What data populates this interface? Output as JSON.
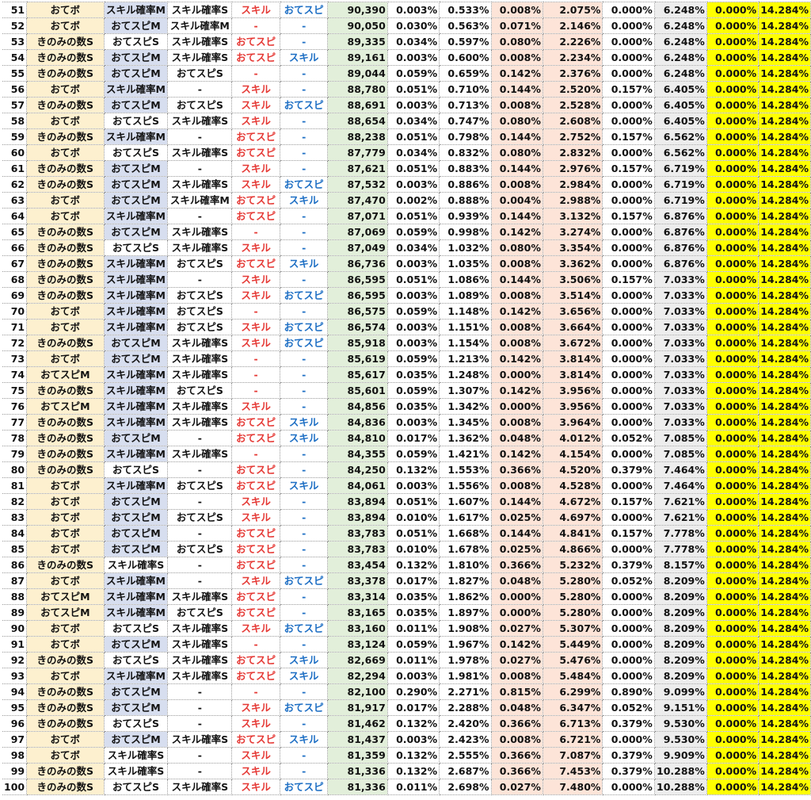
{
  "colors": {
    "main": "#fdf0cf",
    "sub1_bg": "#d7deef",
    "score_bg": "#e2efda",
    "pct_bg": "#fde4d8",
    "grey_bg": "#ededed",
    "yellow_bg": "#ffff00",
    "skill_text": "#e53935",
    "speed_text": "#1e6fc4"
  },
  "rows": [
    {
      "n": "51",
      "main": "おてボ",
      "s1": "スキル確率M",
      "s2": "スキル確率S",
      "p1": "スキル",
      "p2": "おてスピ",
      "score": "90,390",
      "v": [
        "0.003%",
        "0.533%",
        "0.008%",
        "2.075%",
        "0.000%",
        "6.248%",
        "0.000%",
        "14.284%"
      ]
    },
    {
      "n": "52",
      "main": "おてボ",
      "s1": "おてスピM",
      "s2": "スキル確率M",
      "p1": "-",
      "p2": "-",
      "score": "90,050",
      "v": [
        "0.030%",
        "0.563%",
        "0.071%",
        "2.146%",
        "0.000%",
        "6.248%",
        "0.000%",
        "14.284%"
      ]
    },
    {
      "n": "53",
      "main": "きのみの数S",
      "s1": "おてスピS",
      "s2": "スキル確率S",
      "p1": "おてスピ",
      "p2": "-",
      "score": "89,335",
      "v": [
        "0.034%",
        "0.597%",
        "0.080%",
        "2.226%",
        "0.000%",
        "6.248%",
        "0.000%",
        "14.284%"
      ]
    },
    {
      "n": "54",
      "main": "きのみの数S",
      "s1": "おてスピM",
      "s2": "スキル確率S",
      "p1": "おてスピ",
      "p2": "スキル",
      "score": "89,161",
      "v": [
        "0.003%",
        "0.600%",
        "0.008%",
        "2.234%",
        "0.000%",
        "6.248%",
        "0.000%",
        "14.284%"
      ]
    },
    {
      "n": "55",
      "main": "きのみの数S",
      "s1": "おてスピM",
      "s2": "おてスピS",
      "p1": "-",
      "p2": "-",
      "score": "89,044",
      "v": [
        "0.059%",
        "0.659%",
        "0.142%",
        "2.376%",
        "0.000%",
        "6.248%",
        "0.000%",
        "14.284%"
      ]
    },
    {
      "n": "56",
      "main": "おてボ",
      "s1": "スキル確率M",
      "s2": "-",
      "p1": "スキル",
      "p2": "-",
      "score": "88,780",
      "v": [
        "0.051%",
        "0.710%",
        "0.144%",
        "2.520%",
        "0.157%",
        "6.405%",
        "0.000%",
        "14.284%"
      ]
    },
    {
      "n": "57",
      "main": "きのみの数S",
      "s1": "おてスピM",
      "s2": "おてスピS",
      "p1": "スキル",
      "p2": "おてスピ",
      "score": "88,691",
      "v": [
        "0.003%",
        "0.713%",
        "0.008%",
        "2.528%",
        "0.000%",
        "6.405%",
        "0.000%",
        "14.284%"
      ]
    },
    {
      "n": "58",
      "main": "おてボ",
      "s1": "おてスピS",
      "s2": "スキル確率S",
      "p1": "スキル",
      "p2": "-",
      "score": "88,654",
      "v": [
        "0.034%",
        "0.747%",
        "0.080%",
        "2.608%",
        "0.000%",
        "6.405%",
        "0.000%",
        "14.284%"
      ]
    },
    {
      "n": "59",
      "main": "きのみの数S",
      "s1": "スキル確率M",
      "s2": "-",
      "p1": "おてスピ",
      "p2": "-",
      "score": "88,238",
      "v": [
        "0.051%",
        "0.798%",
        "0.144%",
        "2.752%",
        "0.157%",
        "6.562%",
        "0.000%",
        "14.284%"
      ]
    },
    {
      "n": "60",
      "main": "おてボ",
      "s1": "おてスピS",
      "s2": "スキル確率S",
      "p1": "おてスピ",
      "p2": "-",
      "score": "87,779",
      "v": [
        "0.034%",
        "0.832%",
        "0.080%",
        "2.832%",
        "0.000%",
        "6.562%",
        "0.000%",
        "14.284%"
      ]
    },
    {
      "n": "61",
      "main": "きのみの数S",
      "s1": "おてスピM",
      "s2": "-",
      "p1": "スキル",
      "p2": "-",
      "score": "87,621",
      "v": [
        "0.051%",
        "0.883%",
        "0.144%",
        "2.976%",
        "0.157%",
        "6.719%",
        "0.000%",
        "14.284%"
      ]
    },
    {
      "n": "62",
      "main": "きのみの数S",
      "s1": "おてスピM",
      "s2": "スキル確率S",
      "p1": "スキル",
      "p2": "おてスピ",
      "score": "87,532",
      "v": [
        "0.003%",
        "0.886%",
        "0.008%",
        "2.984%",
        "0.000%",
        "6.719%",
        "0.000%",
        "14.284%"
      ]
    },
    {
      "n": "63",
      "main": "おてボ",
      "s1": "おてスピM",
      "s2": "スキル確率M",
      "p1": "おてスピ",
      "p2": "スキル",
      "score": "87,470",
      "v": [
        "0.002%",
        "0.888%",
        "0.004%",
        "2.988%",
        "0.000%",
        "6.719%",
        "0.000%",
        "14.284%"
      ]
    },
    {
      "n": "64",
      "main": "おてボ",
      "s1": "スキル確率M",
      "s2": "-",
      "p1": "おてスピ",
      "p2": "-",
      "score": "87,071",
      "v": [
        "0.051%",
        "0.939%",
        "0.144%",
        "3.132%",
        "0.157%",
        "6.876%",
        "0.000%",
        "14.284%"
      ]
    },
    {
      "n": "65",
      "main": "きのみの数S",
      "s1": "おてスピM",
      "s2": "スキル確率S",
      "p1": "-",
      "p2": "-",
      "score": "87,069",
      "v": [
        "0.059%",
        "0.998%",
        "0.142%",
        "3.274%",
        "0.000%",
        "6.876%",
        "0.000%",
        "14.284%"
      ]
    },
    {
      "n": "66",
      "main": "きのみの数S",
      "s1": "おてスピS",
      "s2": "スキル確率S",
      "p1": "スキル",
      "p2": "-",
      "score": "87,049",
      "v": [
        "0.034%",
        "1.032%",
        "0.080%",
        "3.354%",
        "0.000%",
        "6.876%",
        "0.000%",
        "14.284%"
      ]
    },
    {
      "n": "67",
      "main": "きのみの数S",
      "s1": "スキル確率M",
      "s2": "おてスピS",
      "p1": "おてスピ",
      "p2": "スキル",
      "score": "86,736",
      "v": [
        "0.003%",
        "1.035%",
        "0.008%",
        "3.362%",
        "0.000%",
        "6.876%",
        "0.000%",
        "14.284%"
      ]
    },
    {
      "n": "68",
      "main": "きのみの数S",
      "s1": "スキル確率M",
      "s2": "-",
      "p1": "スキル",
      "p2": "-",
      "score": "86,595",
      "v": [
        "0.051%",
        "1.086%",
        "0.144%",
        "3.506%",
        "0.157%",
        "7.033%",
        "0.000%",
        "14.284%"
      ]
    },
    {
      "n": "69",
      "main": "きのみの数S",
      "s1": "スキル確率M",
      "s2": "おてスピS",
      "p1": "スキル",
      "p2": "おてスピ",
      "score": "86,595",
      "v": [
        "0.003%",
        "1.089%",
        "0.008%",
        "3.514%",
        "0.000%",
        "7.033%",
        "0.000%",
        "14.284%"
      ]
    },
    {
      "n": "70",
      "main": "おてボ",
      "s1": "スキル確率M",
      "s2": "おてスピS",
      "p1": "-",
      "p2": "-",
      "score": "86,575",
      "v": [
        "0.059%",
        "1.148%",
        "0.142%",
        "3.656%",
        "0.000%",
        "7.033%",
        "0.000%",
        "14.284%"
      ]
    },
    {
      "n": "71",
      "main": "おてボ",
      "s1": "スキル確率M",
      "s2": "おてスピS",
      "p1": "スキル",
      "p2": "おてスピ",
      "score": "86,574",
      "v": [
        "0.003%",
        "1.151%",
        "0.008%",
        "3.664%",
        "0.000%",
        "7.033%",
        "0.000%",
        "14.284%"
      ]
    },
    {
      "n": "72",
      "main": "きのみの数S",
      "s1": "おてスピM",
      "s2": "スキル確率S",
      "p1": "スキル",
      "p2": "おてスピ",
      "score": "85,918",
      "v": [
        "0.003%",
        "1.154%",
        "0.008%",
        "3.672%",
        "0.000%",
        "7.033%",
        "0.000%",
        "14.284%"
      ]
    },
    {
      "n": "73",
      "main": "おてボ",
      "s1": "おてスピM",
      "s2": "スキル確率S",
      "p1": "-",
      "p2": "-",
      "score": "85,619",
      "v": [
        "0.059%",
        "1.213%",
        "0.142%",
        "3.814%",
        "0.000%",
        "7.033%",
        "0.000%",
        "14.284%"
      ]
    },
    {
      "n": "74",
      "main": "おてスピM",
      "s1": "スキル確率M",
      "s2": "スキル確率S",
      "p1": "-",
      "p2": "-",
      "score": "85,617",
      "v": [
        "0.035%",
        "1.248%",
        "0.000%",
        "3.814%",
        "0.000%",
        "7.033%",
        "0.000%",
        "14.284%"
      ]
    },
    {
      "n": "75",
      "main": "きのみの数S",
      "s1": "スキル確率M",
      "s2": "おてスピS",
      "p1": "-",
      "p2": "-",
      "score": "85,601",
      "v": [
        "0.059%",
        "1.307%",
        "0.142%",
        "3.956%",
        "0.000%",
        "7.033%",
        "0.000%",
        "14.284%"
      ]
    },
    {
      "n": "76",
      "main": "おてスピM",
      "s1": "スキル確率M",
      "s2": "スキル確率S",
      "p1": "スキル",
      "p2": "-",
      "score": "84,856",
      "v": [
        "0.035%",
        "1.342%",
        "0.000%",
        "3.956%",
        "0.000%",
        "7.033%",
        "0.000%",
        "14.284%"
      ]
    },
    {
      "n": "77",
      "main": "きのみの数S",
      "s1": "スキル確率M",
      "s2": "スキル確率S",
      "p1": "おてスピ",
      "p2": "スキル",
      "score": "84,836",
      "v": [
        "0.003%",
        "1.345%",
        "0.008%",
        "3.964%",
        "0.000%",
        "7.033%",
        "0.000%",
        "14.284%"
      ]
    },
    {
      "n": "78",
      "main": "きのみの数S",
      "s1": "おてスピM",
      "s2": "-",
      "p1": "おてスピ",
      "p2": "スキル",
      "score": "84,810",
      "v": [
        "0.017%",
        "1.362%",
        "0.048%",
        "4.012%",
        "0.052%",
        "7.085%",
        "0.000%",
        "14.284%"
      ]
    },
    {
      "n": "79",
      "main": "きのみの数S",
      "s1": "スキル確率M",
      "s2": "スキル確率S",
      "p1": "-",
      "p2": "-",
      "score": "84,355",
      "v": [
        "0.059%",
        "1.421%",
        "0.142%",
        "4.154%",
        "0.000%",
        "7.085%",
        "0.000%",
        "14.284%"
      ]
    },
    {
      "n": "80",
      "main": "きのみの数S",
      "s1": "おてスピS",
      "s2": "-",
      "p1": "おてスピ",
      "p2": "-",
      "score": "84,250",
      "v": [
        "0.132%",
        "1.553%",
        "0.366%",
        "4.520%",
        "0.379%",
        "7.464%",
        "0.000%",
        "14.284%"
      ]
    },
    {
      "n": "81",
      "main": "おてボ",
      "s1": "スキル確率M",
      "s2": "おてスピS",
      "p1": "おてスピ",
      "p2": "スキル",
      "score": "84,061",
      "v": [
        "0.003%",
        "1.556%",
        "0.008%",
        "4.528%",
        "0.000%",
        "7.464%",
        "0.000%",
        "14.284%"
      ]
    },
    {
      "n": "82",
      "main": "おてボ",
      "s1": "おてスピM",
      "s2": "-",
      "p1": "スキル",
      "p2": "-",
      "score": "83,894",
      "v": [
        "0.051%",
        "1.607%",
        "0.144%",
        "4.672%",
        "0.157%",
        "7.621%",
        "0.000%",
        "14.284%"
      ]
    },
    {
      "n": "83",
      "main": "おてボ",
      "s1": "おてスピM",
      "s2": "おてスピS",
      "p1": "スキル",
      "p2": "-",
      "score": "83,894",
      "v": [
        "0.010%",
        "1.617%",
        "0.025%",
        "4.697%",
        "0.000%",
        "7.621%",
        "0.000%",
        "14.284%"
      ]
    },
    {
      "n": "84",
      "main": "おてボ",
      "s1": "おてスピM",
      "s2": "-",
      "p1": "おてスピ",
      "p2": "-",
      "score": "83,783",
      "v": [
        "0.051%",
        "1.668%",
        "0.144%",
        "4.841%",
        "0.157%",
        "7.778%",
        "0.000%",
        "14.284%"
      ]
    },
    {
      "n": "85",
      "main": "おてボ",
      "s1": "おてスピM",
      "s2": "おてスピS",
      "p1": "おてスピ",
      "p2": "-",
      "score": "83,783",
      "v": [
        "0.010%",
        "1.678%",
        "0.025%",
        "4.866%",
        "0.000%",
        "7.778%",
        "0.000%",
        "14.284%"
      ]
    },
    {
      "n": "86",
      "main": "きのみの数S",
      "s1": "スキル確率S",
      "s2": "-",
      "p1": "おてスピ",
      "p2": "-",
      "score": "83,454",
      "v": [
        "0.132%",
        "1.810%",
        "0.366%",
        "5.232%",
        "0.379%",
        "8.157%",
        "0.000%",
        "14.284%"
      ]
    },
    {
      "n": "87",
      "main": "おてボ",
      "s1": "スキル確率M",
      "s2": "-",
      "p1": "スキル",
      "p2": "おてスピ",
      "score": "83,378",
      "v": [
        "0.017%",
        "1.827%",
        "0.048%",
        "5.280%",
        "0.052%",
        "8.209%",
        "0.000%",
        "14.284%"
      ]
    },
    {
      "n": "88",
      "main": "おてスピM",
      "s1": "スキル確率M",
      "s2": "スキル確率S",
      "p1": "おてスピ",
      "p2": "-",
      "score": "83,314",
      "v": [
        "0.035%",
        "1.862%",
        "0.000%",
        "5.280%",
        "0.000%",
        "8.209%",
        "0.000%",
        "14.284%"
      ]
    },
    {
      "n": "89",
      "main": "おてスピM",
      "s1": "スキル確率M",
      "s2": "おてスピS",
      "p1": "おてスピ",
      "p2": "-",
      "score": "83,165",
      "v": [
        "0.035%",
        "1.897%",
        "0.000%",
        "5.280%",
        "0.000%",
        "8.209%",
        "0.000%",
        "14.284%"
      ]
    },
    {
      "n": "90",
      "main": "おてボ",
      "s1": "おてスピS",
      "s2": "スキル確率S",
      "p1": "スキル",
      "p2": "おてスピ",
      "score": "83,160",
      "v": [
        "0.011%",
        "1.908%",
        "0.027%",
        "5.307%",
        "0.000%",
        "8.209%",
        "0.000%",
        "14.284%"
      ]
    },
    {
      "n": "91",
      "main": "おてボ",
      "s1": "おてスピM",
      "s2": "スキル確率S",
      "p1": "-",
      "p2": "-",
      "score": "83,124",
      "v": [
        "0.059%",
        "1.967%",
        "0.142%",
        "5.449%",
        "0.000%",
        "8.209%",
        "0.000%",
        "14.284%"
      ]
    },
    {
      "n": "92",
      "main": "きのみの数S",
      "s1": "おてスピS",
      "s2": "スキル確率S",
      "p1": "おてスピ",
      "p2": "スキル",
      "score": "82,669",
      "v": [
        "0.011%",
        "1.978%",
        "0.027%",
        "5.476%",
        "0.000%",
        "8.209%",
        "0.000%",
        "14.284%"
      ]
    },
    {
      "n": "93",
      "main": "おてボ",
      "s1": "スキル確率M",
      "s2": "スキル確率S",
      "p1": "おてスピ",
      "p2": "スキル",
      "score": "82,294",
      "v": [
        "0.003%",
        "1.981%",
        "0.008%",
        "5.484%",
        "0.000%",
        "8.209%",
        "0.000%",
        "14.284%"
      ]
    },
    {
      "n": "94",
      "main": "きのみの数S",
      "s1": "おてスピM",
      "s2": "-",
      "p1": "-",
      "p2": "-",
      "score": "82,100",
      "v": [
        "0.290%",
        "2.271%",
        "0.815%",
        "6.299%",
        "0.890%",
        "9.099%",
        "0.000%",
        "14.284%"
      ]
    },
    {
      "n": "95",
      "main": "きのみの数S",
      "s1": "おてスピM",
      "s2": "-",
      "p1": "スキル",
      "p2": "おてスピ",
      "score": "81,917",
      "v": [
        "0.017%",
        "2.288%",
        "0.048%",
        "6.347%",
        "0.052%",
        "9.151%",
        "0.000%",
        "14.284%"
      ]
    },
    {
      "n": "96",
      "main": "きのみの数S",
      "s1": "おてスピS",
      "s2": "-",
      "p1": "スキル",
      "p2": "-",
      "score": "81,462",
      "v": [
        "0.132%",
        "2.420%",
        "0.366%",
        "6.713%",
        "0.379%",
        "9.530%",
        "0.000%",
        "14.284%"
      ]
    },
    {
      "n": "97",
      "main": "おてボ",
      "s1": "おてスピM",
      "s2": "スキル確率S",
      "p1": "おてスピ",
      "p2": "スキル",
      "score": "81,437",
      "v": [
        "0.003%",
        "2.423%",
        "0.008%",
        "6.721%",
        "0.000%",
        "9.530%",
        "0.000%",
        "14.284%"
      ]
    },
    {
      "n": "98",
      "main": "おてボ",
      "s1": "スキル確率S",
      "s2": "-",
      "p1": "スキル",
      "p2": "-",
      "score": "81,359",
      "v": [
        "0.132%",
        "2.555%",
        "0.366%",
        "7.087%",
        "0.379%",
        "9.909%",
        "0.000%",
        "14.284%"
      ]
    },
    {
      "n": "99",
      "main": "きのみの数S",
      "s1": "スキル確率S",
      "s2": "-",
      "p1": "スキル",
      "p2": "-",
      "score": "81,336",
      "v": [
        "0.132%",
        "2.687%",
        "0.366%",
        "7.453%",
        "0.379%",
        "10.288%",
        "0.000%",
        "14.284%"
      ]
    },
    {
      "n": "100",
      "main": "きのみの数S",
      "s1": "おてスピS",
      "s2": "スキル確率S",
      "p1": "スキル",
      "p2": "おてスピ",
      "score": "81,336",
      "v": [
        "0.011%",
        "2.698%",
        "0.027%",
        "7.480%",
        "0.000%",
        "10.288%",
        "0.000%",
        "14.284%"
      ]
    }
  ]
}
